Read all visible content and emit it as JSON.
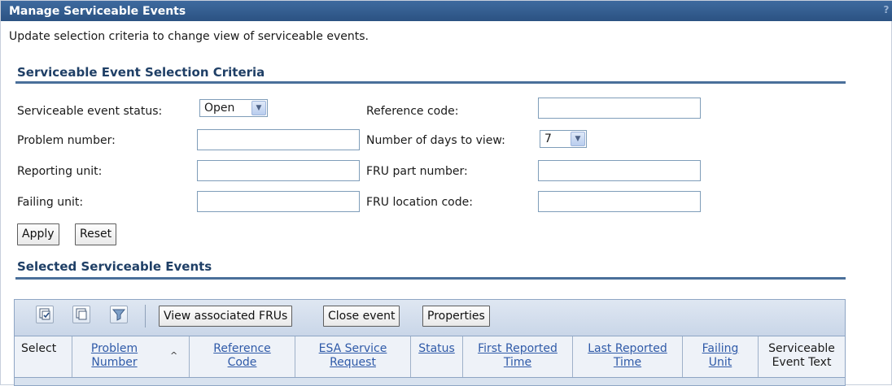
{
  "window": {
    "title": "Manage Serviceable Events",
    "help_glyph": "?"
  },
  "intro": "Update selection criteria to change view of serviceable events.",
  "criteria": {
    "title": "Serviceable Event Selection Criteria",
    "status_label": "Serviceable event status:",
    "status_value": "Open",
    "reference_label": "Reference code:",
    "reference_value": "",
    "problem_label": "Problem number:",
    "problem_value": "",
    "days_label": "Number of days to view:",
    "days_value": "7",
    "reporting_label": "Reporting unit:",
    "reporting_value": "",
    "fru_part_label": "FRU part number:",
    "fru_part_value": "",
    "failing_label": "Failing unit:",
    "failing_value": "",
    "fru_location_label": "FRU location code:",
    "fru_location_value": "",
    "apply_label": "Apply",
    "reset_label": "Reset"
  },
  "selected": {
    "title": "Selected Serviceable Events",
    "toolbar": {
      "icons": [
        "select-all-icon",
        "deselect-all-icon",
        "filter-icon"
      ],
      "view_frus_label": "View associated FRUs",
      "close_event_label": "Close event",
      "properties_label": "Properties"
    },
    "columns": {
      "select": "Select",
      "problem_1": "Problem",
      "problem_2": "Number",
      "sort_glyph": "^",
      "reference_1": "Reference",
      "reference_2": "Code",
      "esa_1": "ESA Service",
      "esa_2": "Request",
      "status": "Status",
      "first_1": "First Reported",
      "first_2": "Time",
      "last_1": "Last Reported",
      "last_2": "Time",
      "failing_1": "Failing",
      "failing_2": "Unit",
      "text_1": "Serviceable",
      "text_2": "Event Text"
    }
  },
  "colors": {
    "titlebar": "#2b5282",
    "link": "#2f5aa8",
    "section_title": "#1f3f66"
  }
}
